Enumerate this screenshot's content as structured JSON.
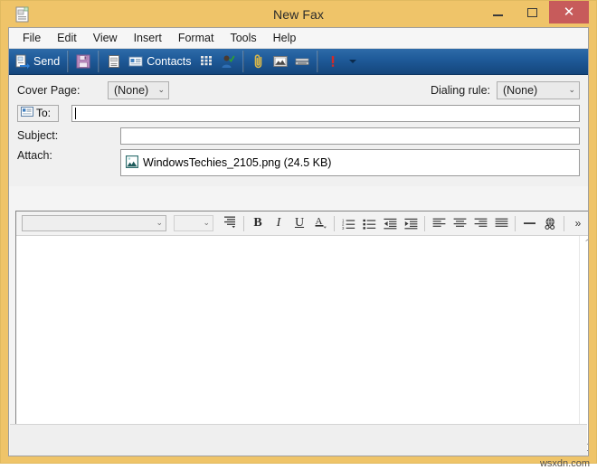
{
  "window": {
    "title": "New Fax",
    "icon": "fax-document-icon",
    "frame_color": "#efc469",
    "controls": {
      "minimize": "minimize-icon",
      "maximize": "maximize-icon",
      "close": "close-icon",
      "close_bg": "#c75b5b"
    }
  },
  "menubar": {
    "items": [
      {
        "label": "File"
      },
      {
        "label": "Edit"
      },
      {
        "label": "View"
      },
      {
        "label": "Insert"
      },
      {
        "label": "Format"
      },
      {
        "label": "Tools"
      },
      {
        "label": "Help"
      }
    ]
  },
  "toolbar": {
    "accent": "#1f5b9a",
    "send_label": "Send",
    "send_icon": "send-fax-icon",
    "save_icon": "save-floppy-icon",
    "properties_icon": "document-properties-icon",
    "contacts_label": "Contacts",
    "contacts_icon": "address-card-icon",
    "dialpad_icon": "dial-pad-icon",
    "check_names_icon": "check-names-person-icon",
    "attach_icon": "paperclip-icon",
    "insert_picture_icon": "insert-picture-icon",
    "scan_icon": "scanner-icon",
    "priority_icon": "high-priority-exclamation-icon",
    "priority_caret_icon": "chevron-down-icon"
  },
  "fields": {
    "cover_page_label": "Cover Page:",
    "cover_page_value": "(None)",
    "dialing_rule_label": "Dialing rule:",
    "dialing_rule_value": "(None)",
    "to_button_label": "To:",
    "to_button_icon": "address-card-icon",
    "to_value": "",
    "to_placeholder": "",
    "subject_label": "Subject:",
    "subject_value": "",
    "subject_placeholder": "",
    "attach_label": "Attach:",
    "attachment_icon": "image-file-icon",
    "attachment_name": "WindowsTechies_2105.png (24.5 KB)"
  },
  "editor": {
    "font_value": "",
    "font_placeholder": "",
    "size_value": "",
    "size_placeholder": "",
    "buttons": [
      {
        "name": "paragraph-style-icon",
        "glyph": "▤"
      },
      {
        "name": "bold-button",
        "glyph": "B"
      },
      {
        "name": "italic-button",
        "glyph": "I"
      },
      {
        "name": "underline-button",
        "glyph": "U"
      },
      {
        "name": "font-color-button",
        "glyph": "A"
      },
      {
        "name": "numbered-list-button",
        "glyph": "≔"
      },
      {
        "name": "bulleted-list-button",
        "glyph": "≡"
      },
      {
        "name": "decrease-indent-button",
        "glyph": "⇤"
      },
      {
        "name": "increase-indent-button",
        "glyph": "⇥"
      },
      {
        "name": "align-left-button",
        "glyph": "≡"
      },
      {
        "name": "align-center-button",
        "glyph": "≡"
      },
      {
        "name": "align-right-button",
        "glyph": "≡"
      },
      {
        "name": "justify-button",
        "glyph": "≡"
      },
      {
        "name": "horizontal-rule-button",
        "glyph": "—"
      },
      {
        "name": "insert-hyperlink-button",
        "glyph": "🌐"
      },
      {
        "name": "overflow-more-button",
        "glyph": "»"
      }
    ],
    "body_text": "",
    "scroll_up_icon": "chevron-up-icon",
    "scroll_down_icon": "chevron-down-icon"
  },
  "watermark": {
    "text": "wsxdn.com"
  }
}
